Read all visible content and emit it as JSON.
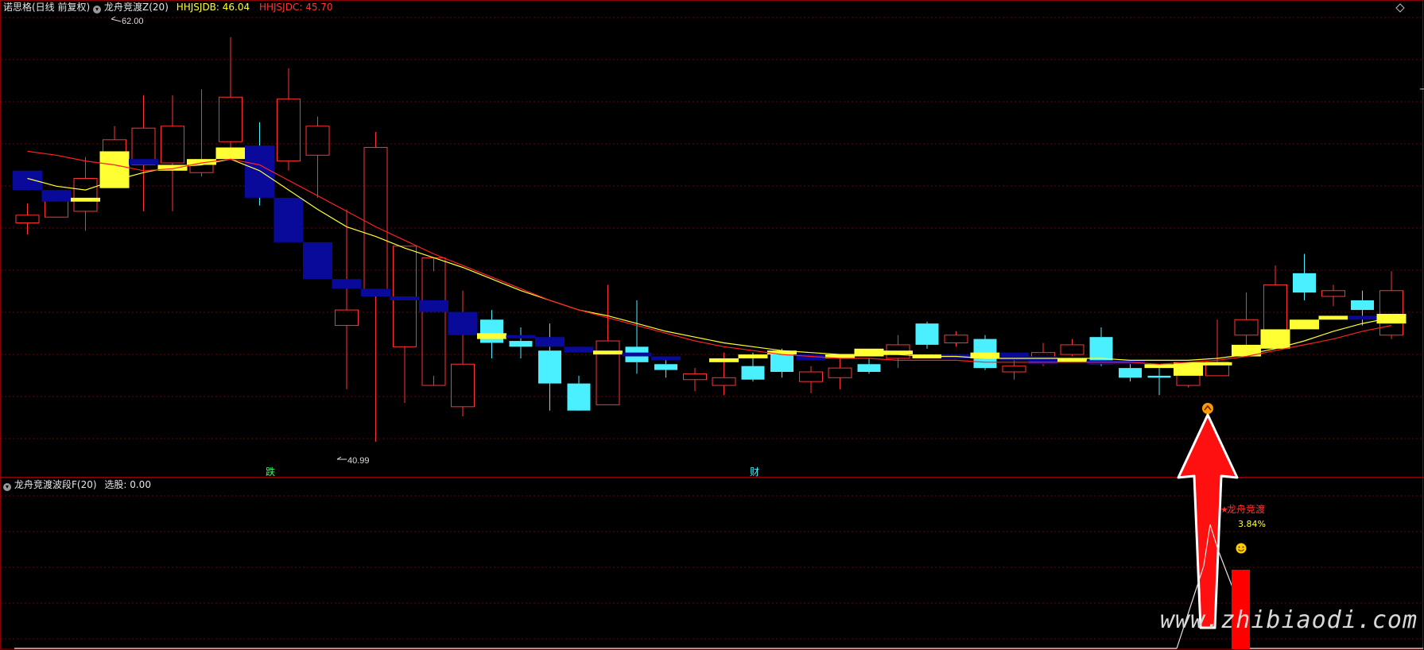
{
  "top_panel": {
    "stock_name": "诺思格(日线 前复权)",
    "indicator_name": "龙舟竞渡Z(20)",
    "hhjsjdb_label": "HHJSJDB: 46.04",
    "hhjsjdc_label": "HHJSJDC: 45.70",
    "high_marker": "62.00",
    "low_marker": "40.99",
    "event_marker_1": "跌",
    "event_marker_2": "财"
  },
  "bottom_panel": {
    "indicator_name": "龙舟竞渡波段F(20)",
    "select_label": "选股: 0.00",
    "signal_label": "龙舟竞渡",
    "signal_value": "3.84%"
  },
  "watermark": "www.zhibiaodi.com",
  "colors": {
    "up_candle": "#ff3333",
    "down_candle": "#4af0ff",
    "yellow_bar": "#ffff33",
    "navy_bar": "#0a0a9a",
    "ma_short": "#ffff33",
    "ma_long": "#ff2020",
    "grid": "#6a0000",
    "arrow": "#ff0000"
  },
  "chart_data": {
    "type": "candlestick",
    "y_range": [
      40,
      63
    ],
    "candles": [
      {
        "o": 52.7,
        "c": 52.3,
        "h": 53.3,
        "l": 51.7,
        "kind": "up"
      },
      {
        "o": 53.7,
        "c": 52.6,
        "h": 53.7,
        "l": 52.6,
        "kind": "up"
      },
      {
        "o": 52.9,
        "c": 54.6,
        "h": 55.7,
        "l": 51.9,
        "kind": "up"
      },
      {
        "o": 56.6,
        "c": 55.4,
        "h": 57.3,
        "l": 55.3,
        "kind": "up"
      },
      {
        "o": 55.3,
        "c": 57.2,
        "h": 58.9,
        "l": 52.9,
        "kind": "up"
      },
      {
        "o": 55.4,
        "c": 57.3,
        "h": 58.9,
        "l": 52.9,
        "kind": "up"
      },
      {
        "o": 54.9,
        "c": 55.4,
        "h": 59.2,
        "l": 54.7,
        "kind": "up"
      },
      {
        "o": 56.5,
        "c": 58.8,
        "h": 61.9,
        "l": 56.0,
        "kind": "up"
      },
      {
        "o": 56.0,
        "c": 53.9,
        "h": 57.5,
        "l": 53.2,
        "kind": "down"
      },
      {
        "o": 55.5,
        "c": 58.7,
        "h": 60.3,
        "l": 55.0,
        "kind": "up"
      },
      {
        "o": 57.3,
        "c": 55.8,
        "h": 57.8,
        "l": 53.6,
        "kind": "up"
      },
      {
        "o": 47.0,
        "c": 47.8,
        "h": 53.0,
        "l": 43.7,
        "kind": "up"
      },
      {
        "o": 56.2,
        "c": 48.6,
        "h": 57.0,
        "l": 40.99,
        "kind": "up"
      },
      {
        "o": 51.1,
        "c": 45.9,
        "h": 51.1,
        "l": 43.0,
        "kind": "up"
      },
      {
        "o": 50.5,
        "c": 43.9,
        "h": 49.8,
        "l": 44.4,
        "kind": "up"
      },
      {
        "o": 45.0,
        "c": 42.8,
        "h": 48.8,
        "l": 42.3,
        "kind": "up"
      },
      {
        "o": 47.3,
        "c": 46.1,
        "h": 47.8,
        "l": 45.3,
        "kind": "down"
      },
      {
        "o": 46.2,
        "c": 45.9,
        "h": 46.9,
        "l": 45.3,
        "kind": "down"
      },
      {
        "o": 45.7,
        "c": 44.0,
        "h": 47.1,
        "l": 42.6,
        "kind": "down"
      },
      {
        "o": 44.0,
        "c": 42.6,
        "h": 44.4,
        "l": 42.7,
        "kind": "down"
      },
      {
        "o": 46.2,
        "c": 42.9,
        "h": 49.1,
        "l": 42.9,
        "kind": "up"
      },
      {
        "o": 45.9,
        "c": 45.1,
        "h": 48.3,
        "l": 44.5,
        "kind": "down"
      },
      {
        "o": 45.0,
        "c": 44.7,
        "h": 45.4,
        "l": 44.3,
        "kind": "down"
      },
      {
        "o": 44.2,
        "c": 44.5,
        "h": 44.8,
        "l": 43.6,
        "kind": "up"
      },
      {
        "o": 43.9,
        "c": 44.3,
        "h": 45.6,
        "l": 43.4,
        "kind": "up"
      },
      {
        "o": 44.9,
        "c": 44.2,
        "h": 45.6,
        "l": 44.1,
        "kind": "down"
      },
      {
        "o": 45.6,
        "c": 44.6,
        "h": 45.8,
        "l": 44.3,
        "kind": "down"
      },
      {
        "o": 44.1,
        "c": 44.6,
        "h": 44.9,
        "l": 43.5,
        "kind": "up"
      },
      {
        "o": 44.3,
        "c": 44.8,
        "h": 45.5,
        "l": 43.7,
        "kind": "up"
      },
      {
        "o": 45.0,
        "c": 44.6,
        "h": 45.3,
        "l": 44.5,
        "kind": "down"
      },
      {
        "o": 45.3,
        "c": 46.0,
        "h": 46.5,
        "l": 44.8,
        "kind": "up"
      },
      {
        "o": 47.1,
        "c": 46.0,
        "h": 47.2,
        "l": 45.8,
        "kind": "down"
      },
      {
        "o": 46.1,
        "c": 46.5,
        "h": 46.7,
        "l": 45.9,
        "kind": "up"
      },
      {
        "o": 46.3,
        "c": 44.8,
        "h": 46.5,
        "l": 44.7,
        "kind": "down"
      },
      {
        "o": 44.9,
        "c": 44.6,
        "h": 45.2,
        "l": 44.2,
        "kind": "up"
      },
      {
        "o": 45.6,
        "c": 45.2,
        "h": 46.1,
        "l": 44.9,
        "kind": "up"
      },
      {
        "o": 45.5,
        "c": 46.0,
        "h": 46.3,
        "l": 45.4,
        "kind": "up"
      },
      {
        "o": 46.4,
        "c": 45.0,
        "h": 46.9,
        "l": 44.9,
        "kind": "down"
      },
      {
        "o": 44.8,
        "c": 44.3,
        "h": 45.1,
        "l": 44.1,
        "kind": "down"
      },
      {
        "o": 44.3,
        "c": 44.4,
        "h": 44.8,
        "l": 43.4,
        "kind": "down"
      },
      {
        "o": 43.9,
        "c": 44.9,
        "h": 45.0,
        "l": 43.8,
        "kind": "up"
      },
      {
        "o": 44.4,
        "c": 45.1,
        "h": 47.3,
        "l": 44.4,
        "kind": "up"
      },
      {
        "o": 46.5,
        "c": 47.3,
        "h": 48.7,
        "l": 46.0,
        "kind": "up"
      },
      {
        "o": 46.5,
        "c": 49.1,
        "h": 50.1,
        "l": 46.4,
        "kind": "up"
      },
      {
        "o": 48.7,
        "c": 49.7,
        "h": 50.7,
        "l": 48.3,
        "kind": "down"
      },
      {
        "o": 48.5,
        "c": 48.8,
        "h": 49.1,
        "l": 48.0,
        "kind": "up"
      },
      {
        "o": 47.8,
        "c": 48.3,
        "h": 48.8,
        "l": 47.0,
        "kind": "down"
      },
      {
        "o": 46.5,
        "c": 48.8,
        "h": 49.8,
        "l": 46.3,
        "kind": "up"
      }
    ],
    "overlay_bars": [
      {
        "i": 0,
        "top": 55.0,
        "bot": 54.0,
        "color": "navy"
      },
      {
        "i": 1,
        "top": 54.0,
        "bot": 53.4,
        "color": "navy"
      },
      {
        "i": 2,
        "top": 53.6,
        "bot": 53.4,
        "color": "yellow"
      },
      {
        "i": 3,
        "top": 56.0,
        "bot": 54.1,
        "color": "yellow"
      },
      {
        "i": 4,
        "top": 55.6,
        "bot": 55.3,
        "color": "navy"
      },
      {
        "i": 5,
        "top": 55.3,
        "bot": 55.0,
        "color": "yellow"
      },
      {
        "i": 6,
        "top": 55.6,
        "bot": 55.3,
        "color": "yellow"
      },
      {
        "i": 7,
        "top": 56.2,
        "bot": 55.6,
        "color": "yellow"
      },
      {
        "i": 8,
        "top": 56.3,
        "bot": 53.6,
        "color": "navy"
      },
      {
        "i": 9,
        "top": 53.6,
        "bot": 51.3,
        "color": "navy"
      },
      {
        "i": 10,
        "top": 51.3,
        "bot": 49.4,
        "color": "navy"
      },
      {
        "i": 11,
        "top": 49.4,
        "bot": 48.9,
        "color": "navy"
      },
      {
        "i": 12,
        "top": 48.9,
        "bot": 48.5,
        "color": "navy"
      },
      {
        "i": 13,
        "top": 48.5,
        "bot": 48.3,
        "color": "navy"
      },
      {
        "i": 14,
        "top": 48.3,
        "bot": 47.7,
        "color": "navy"
      },
      {
        "i": 15,
        "top": 47.7,
        "bot": 46.5,
        "color": "navy"
      },
      {
        "i": 16,
        "top": 46.6,
        "bot": 46.3,
        "color": "yellow"
      },
      {
        "i": 17,
        "top": 46.5,
        "bot": 46.4,
        "color": "navy"
      },
      {
        "i": 18,
        "top": 46.4,
        "bot": 45.9,
        "color": "navy"
      },
      {
        "i": 19,
        "top": 45.9,
        "bot": 45.6,
        "color": "navy"
      },
      {
        "i": 20,
        "top": 45.7,
        "bot": 45.5,
        "color": "yellow"
      },
      {
        "i": 21,
        "top": 45.6,
        "bot": 45.4,
        "color": "navy"
      },
      {
        "i": 22,
        "top": 45.4,
        "bot": 45.2,
        "color": "navy"
      },
      {
        "i": 24,
        "top": 45.3,
        "bot": 45.1,
        "color": "yellow"
      },
      {
        "i": 25,
        "top": 45.5,
        "bot": 45.3,
        "color": "yellow"
      },
      {
        "i": 26,
        "top": 45.7,
        "bot": 45.5,
        "color": "yellow"
      },
      {
        "i": 27,
        "top": 45.5,
        "bot": 45.2,
        "color": "navy"
      },
      {
        "i": 28,
        "top": 45.5,
        "bot": 45.3,
        "color": "yellow"
      },
      {
        "i": 29,
        "top": 45.8,
        "bot": 45.4,
        "color": "yellow"
      },
      {
        "i": 30,
        "top": 45.7,
        "bot": 45.5,
        "color": "yellow"
      },
      {
        "i": 31,
        "top": 45.5,
        "bot": 45.3,
        "color": "yellow"
      },
      {
        "i": 32,
        "top": 45.5,
        "bot": 45.3,
        "color": "navy"
      },
      {
        "i": 33,
        "top": 45.6,
        "bot": 45.3,
        "color": "yellow"
      },
      {
        "i": 34,
        "top": 45.6,
        "bot": 45.2,
        "color": "navy"
      },
      {
        "i": 35,
        "top": 45.4,
        "bot": 45.0,
        "color": "navy"
      },
      {
        "i": 36,
        "top": 45.3,
        "bot": 45.1,
        "color": "yellow"
      },
      {
        "i": 37,
        "top": 45.2,
        "bot": 45.0,
        "color": "navy"
      },
      {
        "i": 38,
        "top": 45.2,
        "bot": 45.0,
        "color": "navy"
      },
      {
        "i": 39,
        "top": 45.0,
        "bot": 44.8,
        "color": "yellow"
      },
      {
        "i": 40,
        "top": 45.1,
        "bot": 44.4,
        "color": "yellow"
      },
      {
        "i": 41,
        "top": 45.1,
        "bot": 45.0,
        "color": "yellow"
      },
      {
        "i": 42,
        "top": 46.0,
        "bot": 45.4,
        "color": "yellow"
      },
      {
        "i": 43,
        "top": 46.8,
        "bot": 45.8,
        "color": "yellow"
      },
      {
        "i": 44,
        "top": 47.3,
        "bot": 46.8,
        "color": "yellow"
      },
      {
        "i": 45,
        "top": 47.5,
        "bot": 47.3,
        "color": "yellow"
      },
      {
        "i": 46,
        "top": 47.5,
        "bot": 47.3,
        "color": "navy"
      },
      {
        "i": 47,
        "top": 47.6,
        "bot": 47.1,
        "color": "yellow"
      }
    ],
    "ma_short": [
      54.6,
      54.2,
      54.0,
      54.5,
      54.9,
      55.2,
      55.3,
      55.6,
      55.0,
      54.0,
      53.0,
      52.1,
      51.6,
      51.0,
      50.5,
      50.0,
      49.4,
      48.8,
      48.3,
      47.8,
      47.5,
      47.1,
      46.7,
      46.4,
      46.1,
      45.9,
      45.7,
      45.6,
      45.5,
      45.5,
      45.5,
      45.4,
      45.4,
      45.3,
      45.3,
      45.3,
      45.3,
      45.3,
      45.2,
      45.2,
      45.2,
      45.3,
      45.5,
      45.8,
      46.2,
      46.7,
      47.1,
      47.4
    ],
    "ma_long": [
      56.0,
      55.8,
      55.5,
      55.3,
      55.0,
      55.1,
      55.4,
      55.6,
      55.3,
      54.5,
      53.7,
      52.9,
      52.1,
      51.4,
      50.7,
      50.1,
      49.5,
      48.9,
      48.3,
      47.8,
      47.4,
      47.0,
      46.6,
      46.2,
      45.9,
      45.7,
      45.5,
      45.4,
      45.3,
      45.3,
      45.2,
      45.2,
      45.2,
      45.1,
      45.1,
      45.1,
      45.1,
      45.1,
      45.1,
      45.0,
      45.1,
      45.2,
      45.4,
      45.7,
      46.0,
      46.3,
      46.7,
      47.0
    ]
  }
}
